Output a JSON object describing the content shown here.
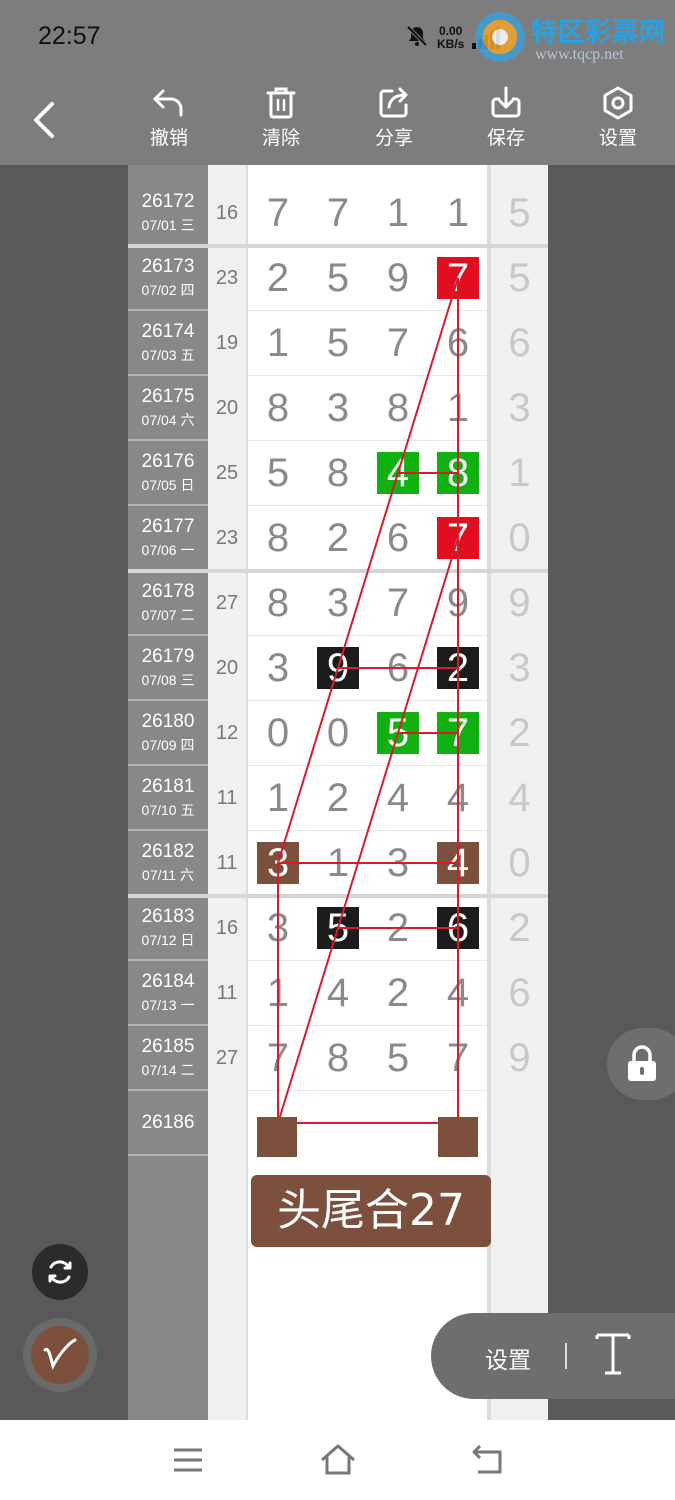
{
  "status": {
    "time": "22:57",
    "speed_value": "0.00",
    "speed_unit": "KB/s"
  },
  "watermark": {
    "title": "特区彩票网",
    "url": "www.tqcp.net"
  },
  "toolbar": {
    "undo_label": "撤销",
    "clear_label": "清除",
    "share_label": "分享",
    "save_label": "保存",
    "settings_label": "设置"
  },
  "rows": [
    {
      "issue": "26172",
      "date": "07/01 三",
      "sum": "16",
      "digits": [
        "7",
        "7",
        "1",
        "1"
      ],
      "last": "5"
    },
    {
      "issue": "26173",
      "date": "07/02 四",
      "sum": "23",
      "digits": [
        "2",
        "5",
        "9",
        "7"
      ],
      "last": "5"
    },
    {
      "issue": "26174",
      "date": "07/03 五",
      "sum": "19",
      "digits": [
        "1",
        "5",
        "7",
        "6"
      ],
      "last": "6"
    },
    {
      "issue": "26175",
      "date": "07/04 六",
      "sum": "20",
      "digits": [
        "8",
        "3",
        "8",
        "1"
      ],
      "last": "3"
    },
    {
      "issue": "26176",
      "date": "07/05 日",
      "sum": "25",
      "digits": [
        "5",
        "8",
        "4",
        "8"
      ],
      "last": "1"
    },
    {
      "issue": "26177",
      "date": "07/06 一",
      "sum": "23",
      "digits": [
        "8",
        "2",
        "6",
        "7"
      ],
      "last": "0"
    },
    {
      "issue": "26178",
      "date": "07/07 二",
      "sum": "27",
      "digits": [
        "8",
        "3",
        "7",
        "9"
      ],
      "last": "9"
    },
    {
      "issue": "26179",
      "date": "07/08 三",
      "sum": "20",
      "digits": [
        "3",
        "9",
        "6",
        "2"
      ],
      "last": "3"
    },
    {
      "issue": "26180",
      "date": "07/09 四",
      "sum": "12",
      "digits": [
        "0",
        "0",
        "5",
        "7"
      ],
      "last": "2"
    },
    {
      "issue": "26181",
      "date": "07/10 五",
      "sum": "11",
      "digits": [
        "1",
        "2",
        "4",
        "4"
      ],
      "last": "4"
    },
    {
      "issue": "26182",
      "date": "07/11 六",
      "sum": "11",
      "digits": [
        "3",
        "1",
        "3",
        "4"
      ],
      "last": "0"
    },
    {
      "issue": "26183",
      "date": "07/12 日",
      "sum": "16",
      "digits": [
        "3",
        "5",
        "2",
        "6"
      ],
      "last": "2"
    },
    {
      "issue": "26184",
      "date": "07/13 一",
      "sum": "11",
      "digits": [
        "1",
        "4",
        "2",
        "4"
      ],
      "last": "6"
    },
    {
      "issue": "26185",
      "date": "07/14 二",
      "sum": "27",
      "digits": [
        "7",
        "8",
        "5",
        "7"
      ],
      "last": "9"
    }
  ],
  "highlights": [
    {
      "row": 1,
      "col": 3,
      "color": "#e00e1e"
    },
    {
      "row": 4,
      "col": 2,
      "color": "#12b112"
    },
    {
      "row": 4,
      "col": 3,
      "color": "#12b112"
    },
    {
      "row": 5,
      "col": 3,
      "color": "#e00e1e"
    },
    {
      "row": 7,
      "col": 1,
      "color": "#1c1c1c"
    },
    {
      "row": 7,
      "col": 3,
      "color": "#1c1c1c"
    },
    {
      "row": 8,
      "col": 2,
      "color": "#12b112"
    },
    {
      "row": 8,
      "col": 3,
      "color": "#12b112"
    },
    {
      "row": 10,
      "col": 0,
      "color": "#7d4f3d"
    },
    {
      "row": 10,
      "col": 3,
      "color": "#7d4f3d"
    },
    {
      "row": 11,
      "col": 1,
      "color": "#1c1c1c"
    },
    {
      "row": 11,
      "col": 3,
      "color": "#1c1c1c"
    }
  ],
  "next_issue": "26186",
  "result_label": "头尾合27",
  "settings_panel": {
    "label": "设置"
  },
  "annotation_color": "#d81b2c"
}
